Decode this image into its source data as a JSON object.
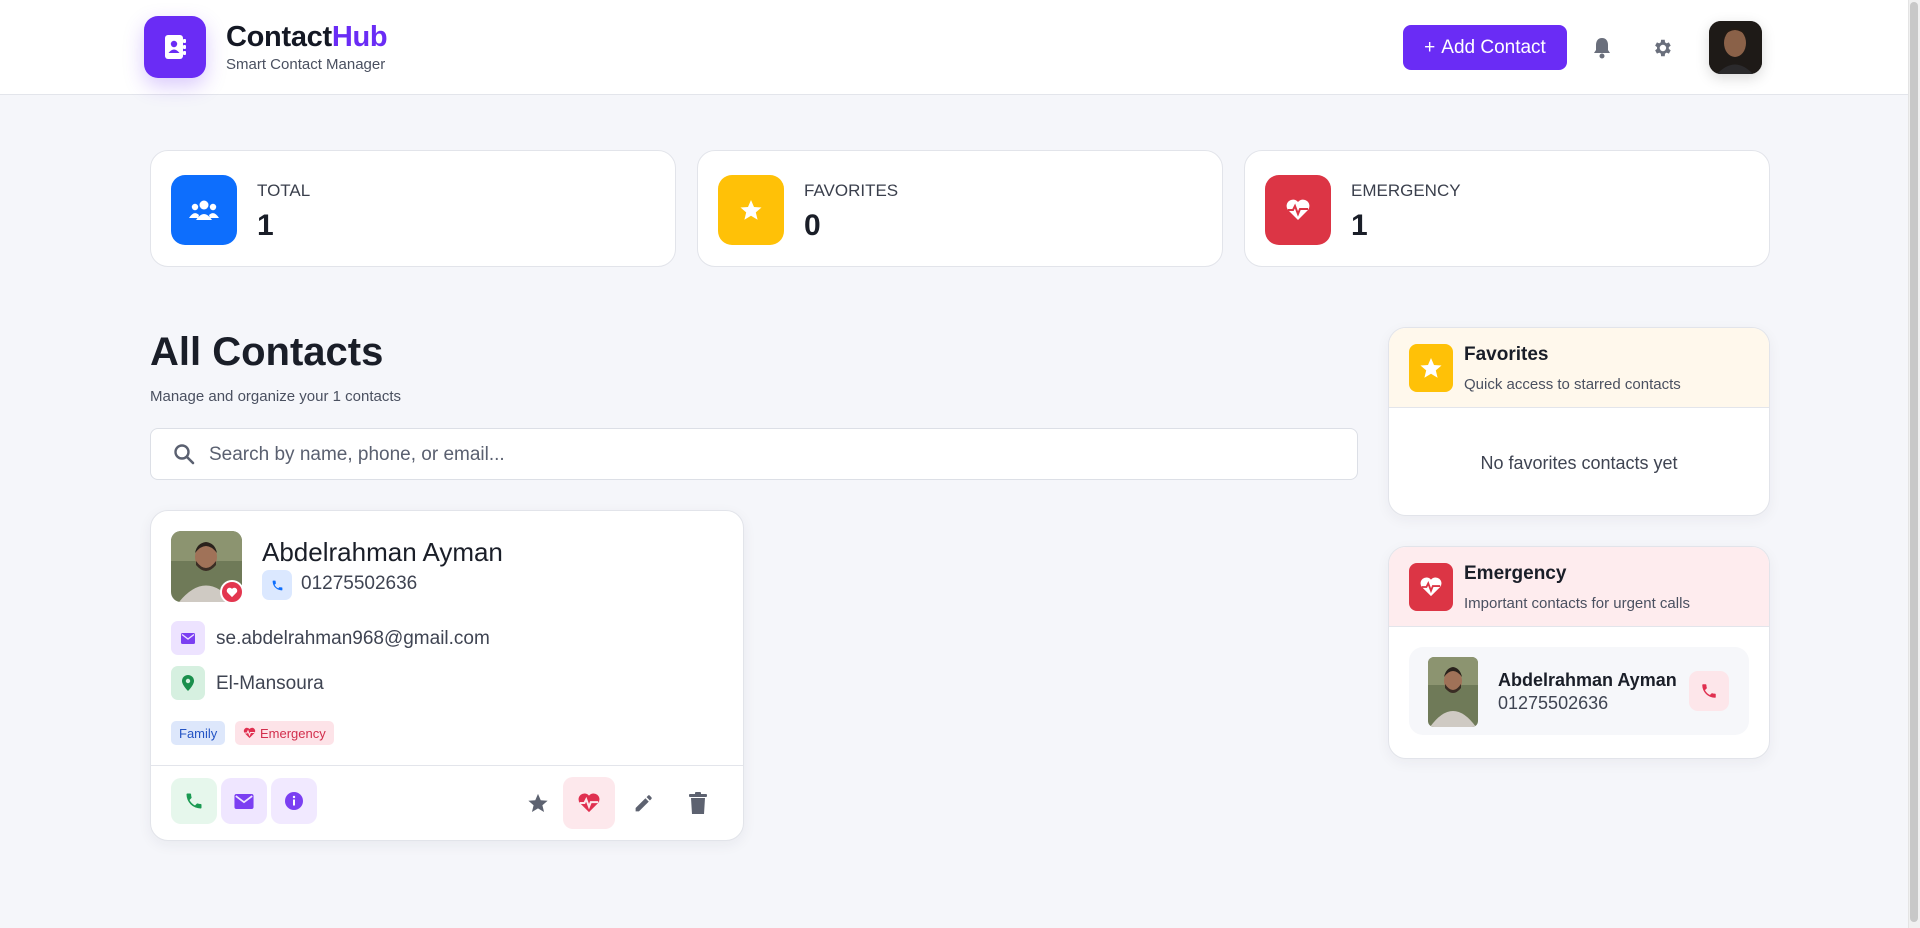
{
  "header": {
    "brand_main": "Contact",
    "brand_accent": "Hub",
    "brand_sub": "Smart Contact Manager",
    "add_button": "Add Contact",
    "add_button_icon": "+",
    "accent_color": "#6a2cf5"
  },
  "stats": [
    {
      "label": "TOTAL",
      "value": "1",
      "icon": "users-icon",
      "color": "#0d6efd"
    },
    {
      "label": "FAVORITES",
      "value": "0",
      "icon": "star-icon",
      "color": "#ffc107"
    },
    {
      "label": "EMERGENCY",
      "value": "1",
      "icon": "heart-pulse-icon",
      "color": "#dc3545"
    }
  ],
  "main": {
    "title": "All Contacts",
    "subtitle": "Manage and organize your 1 contacts",
    "search_placeholder": "Search by name, phone, or email..."
  },
  "contacts": [
    {
      "name": "Abdelrahman Ayman",
      "phone": "01275502636",
      "email": "se.abdelrahman968@gmail.com",
      "address": "El-Mansoura",
      "tags": [
        "Family",
        "Emergency"
      ],
      "is_emergency": true,
      "is_favorite": false
    }
  ],
  "favorites_panel": {
    "title": "Favorites",
    "subtitle": "Quick access to starred contacts",
    "empty_text": "No favorites contacts yet"
  },
  "emergency_panel": {
    "title": "Emergency",
    "subtitle": "Important contacts for urgent calls",
    "items": [
      {
        "name": "Abdelrahman Ayman",
        "phone": "01275502636"
      }
    ]
  }
}
